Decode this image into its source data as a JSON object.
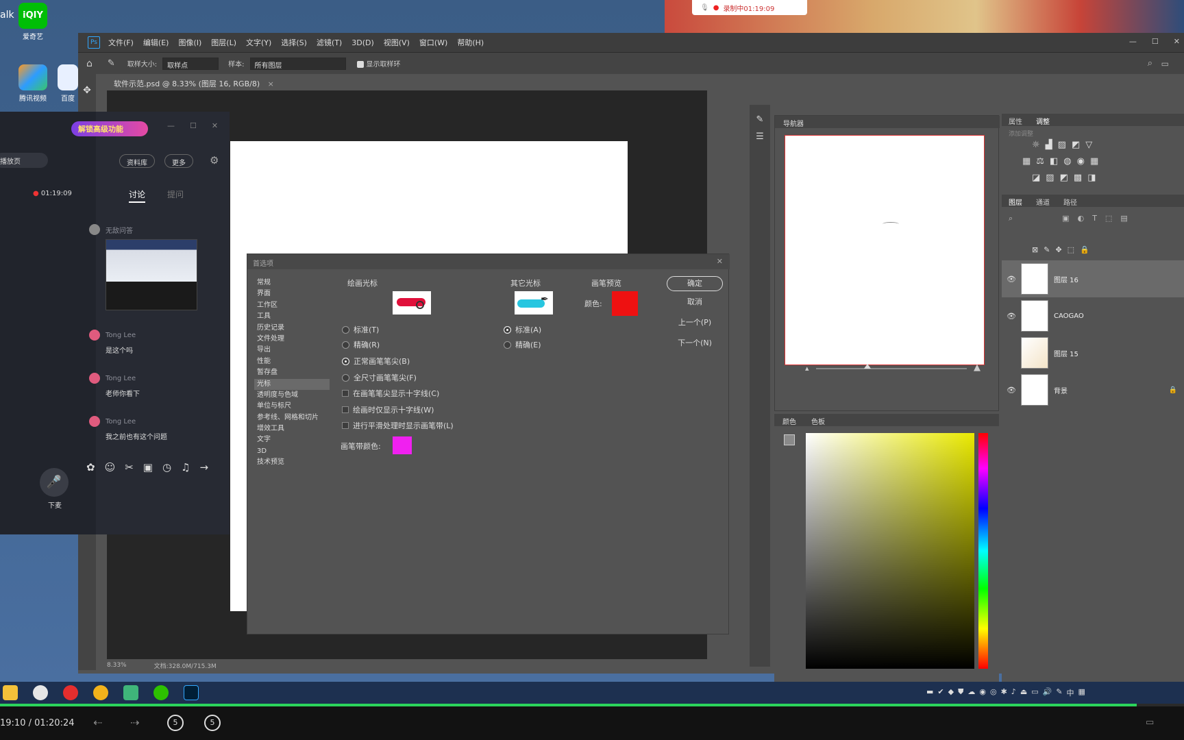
{
  "desktop": {
    "icons": [
      {
        "label": "爱奇艺",
        "icon": "iqiyi-icon",
        "color": "#00be06"
      },
      {
        "label": "腾讯视频",
        "icon": "tencent-video-icon",
        "color": "#2d9cff"
      },
      {
        "label": "百度",
        "icon": "baidu-icon",
        "color": "#e8f0ff"
      }
    ],
    "left_text": "alk"
  },
  "recording": {
    "label": "录制中01:19:09"
  },
  "photoshop": {
    "logo": "Ps",
    "menus": [
      "文件(F)",
      "编辑(E)",
      "图像(I)",
      "图层(L)",
      "文字(Y)",
      "选择(S)",
      "滤镜(T)",
      "3D(D)",
      "视图(V)",
      "窗口(W)",
      "帮助(H)"
    ],
    "options": {
      "sample_size_label": "取样大小:",
      "sample_size_value": "取样点",
      "sample_label": "样本:",
      "sample_value": "所有图层",
      "show_ring_label": "显示取样环"
    },
    "doc_tab": "软件示范.psd @ 8.33% (图层 16, RGB/8)",
    "status": {
      "zoom": "8.33%",
      "doc": "文档:328.0M/715.3M"
    },
    "navigator": {
      "title": "导航器"
    },
    "properties": {
      "tabs": [
        "属性",
        "调整"
      ],
      "label": "添加调整"
    },
    "layers": {
      "tabs": [
        "图层",
        "通道",
        "路径"
      ],
      "rows": [
        {
          "name": "图层 16",
          "active": true
        },
        {
          "name": "CAOGAO",
          "active": false
        },
        {
          "name": "图层 15",
          "active": false
        },
        {
          "name": "背景",
          "active": false
        }
      ]
    },
    "color_panel": {
      "tabs": [
        "颜色",
        "色板"
      ]
    }
  },
  "preferences": {
    "title": "首选项",
    "categories": [
      "常规",
      "界面",
      "工作区",
      "工具",
      "历史记录",
      "文件处理",
      "导出",
      "性能",
      "暂存盘",
      "光标",
      "透明度与色域",
      "单位与标尺",
      "参考线、网格和切片",
      "增效工具",
      "文字",
      "3D",
      "技术预览"
    ],
    "selected_category": "光标",
    "painting_cursors": {
      "title": "绘画光标",
      "radios": [
        "标准(T)",
        "精确(R)",
        "正常画笔笔尖(B)",
        "全尺寸画笔笔尖(F)"
      ],
      "selected": "正常画笔笔尖(B)",
      "checkboxes": [
        "在画笔笔尖显示十字线(C)",
        "绘画时仅显示十字线(W)",
        "进行平滑处理时显示画笔带(L)"
      ],
      "brush_leash_color_label": "画笔带颜色:",
      "brush_leash_color": "#f020f0"
    },
    "other_cursors": {
      "title": "其它光标",
      "radios": [
        "标准(A)",
        "精确(E)"
      ],
      "selected": "标准(A)"
    },
    "brush_preview": {
      "title": "画笔预览",
      "color_label": "颜色:",
      "color": "#ee1111"
    },
    "buttons": {
      "ok": "确定",
      "cancel": "取消",
      "prev": "上一个(P)",
      "next": "下一个(N)"
    }
  },
  "chat": {
    "badge": "解锁高级功能",
    "side_label": "播放页",
    "side_time": "01:19:09",
    "buttons": [
      "资料库",
      "更多"
    ],
    "tabs": [
      "讨论",
      "提问"
    ],
    "active_tab": "讨论",
    "first_sender": "无敌问答",
    "messages": [
      {
        "name": "Tong Lee",
        "text": "是这个吗"
      },
      {
        "name": "Tong Lee",
        "text": "老师你看下"
      },
      {
        "name": "Tong Lee",
        "text": "我之前也有这个问题"
      }
    ],
    "mic_label": "下麦"
  },
  "taskbar": {
    "apps": [
      {
        "icon": "file-explorer-icon",
        "color": "#f3c13a"
      },
      {
        "icon": "chat-app-icon",
        "color": "#e6e6e6"
      },
      {
        "icon": "netease-music-icon",
        "color": "#e62e2e"
      },
      {
        "icon": "chrome-icon",
        "color": "#f2b21b"
      },
      {
        "icon": "app-folder-icon",
        "color": "#3fb57a"
      },
      {
        "icon": "wechat-icon",
        "color": "#2dc100"
      },
      {
        "icon": "photoshop-icon",
        "color": "#31a8ff"
      }
    ],
    "ime": "中"
  },
  "player": {
    "time": "19:10 / 01:20:24",
    "progress": 0.96
  }
}
